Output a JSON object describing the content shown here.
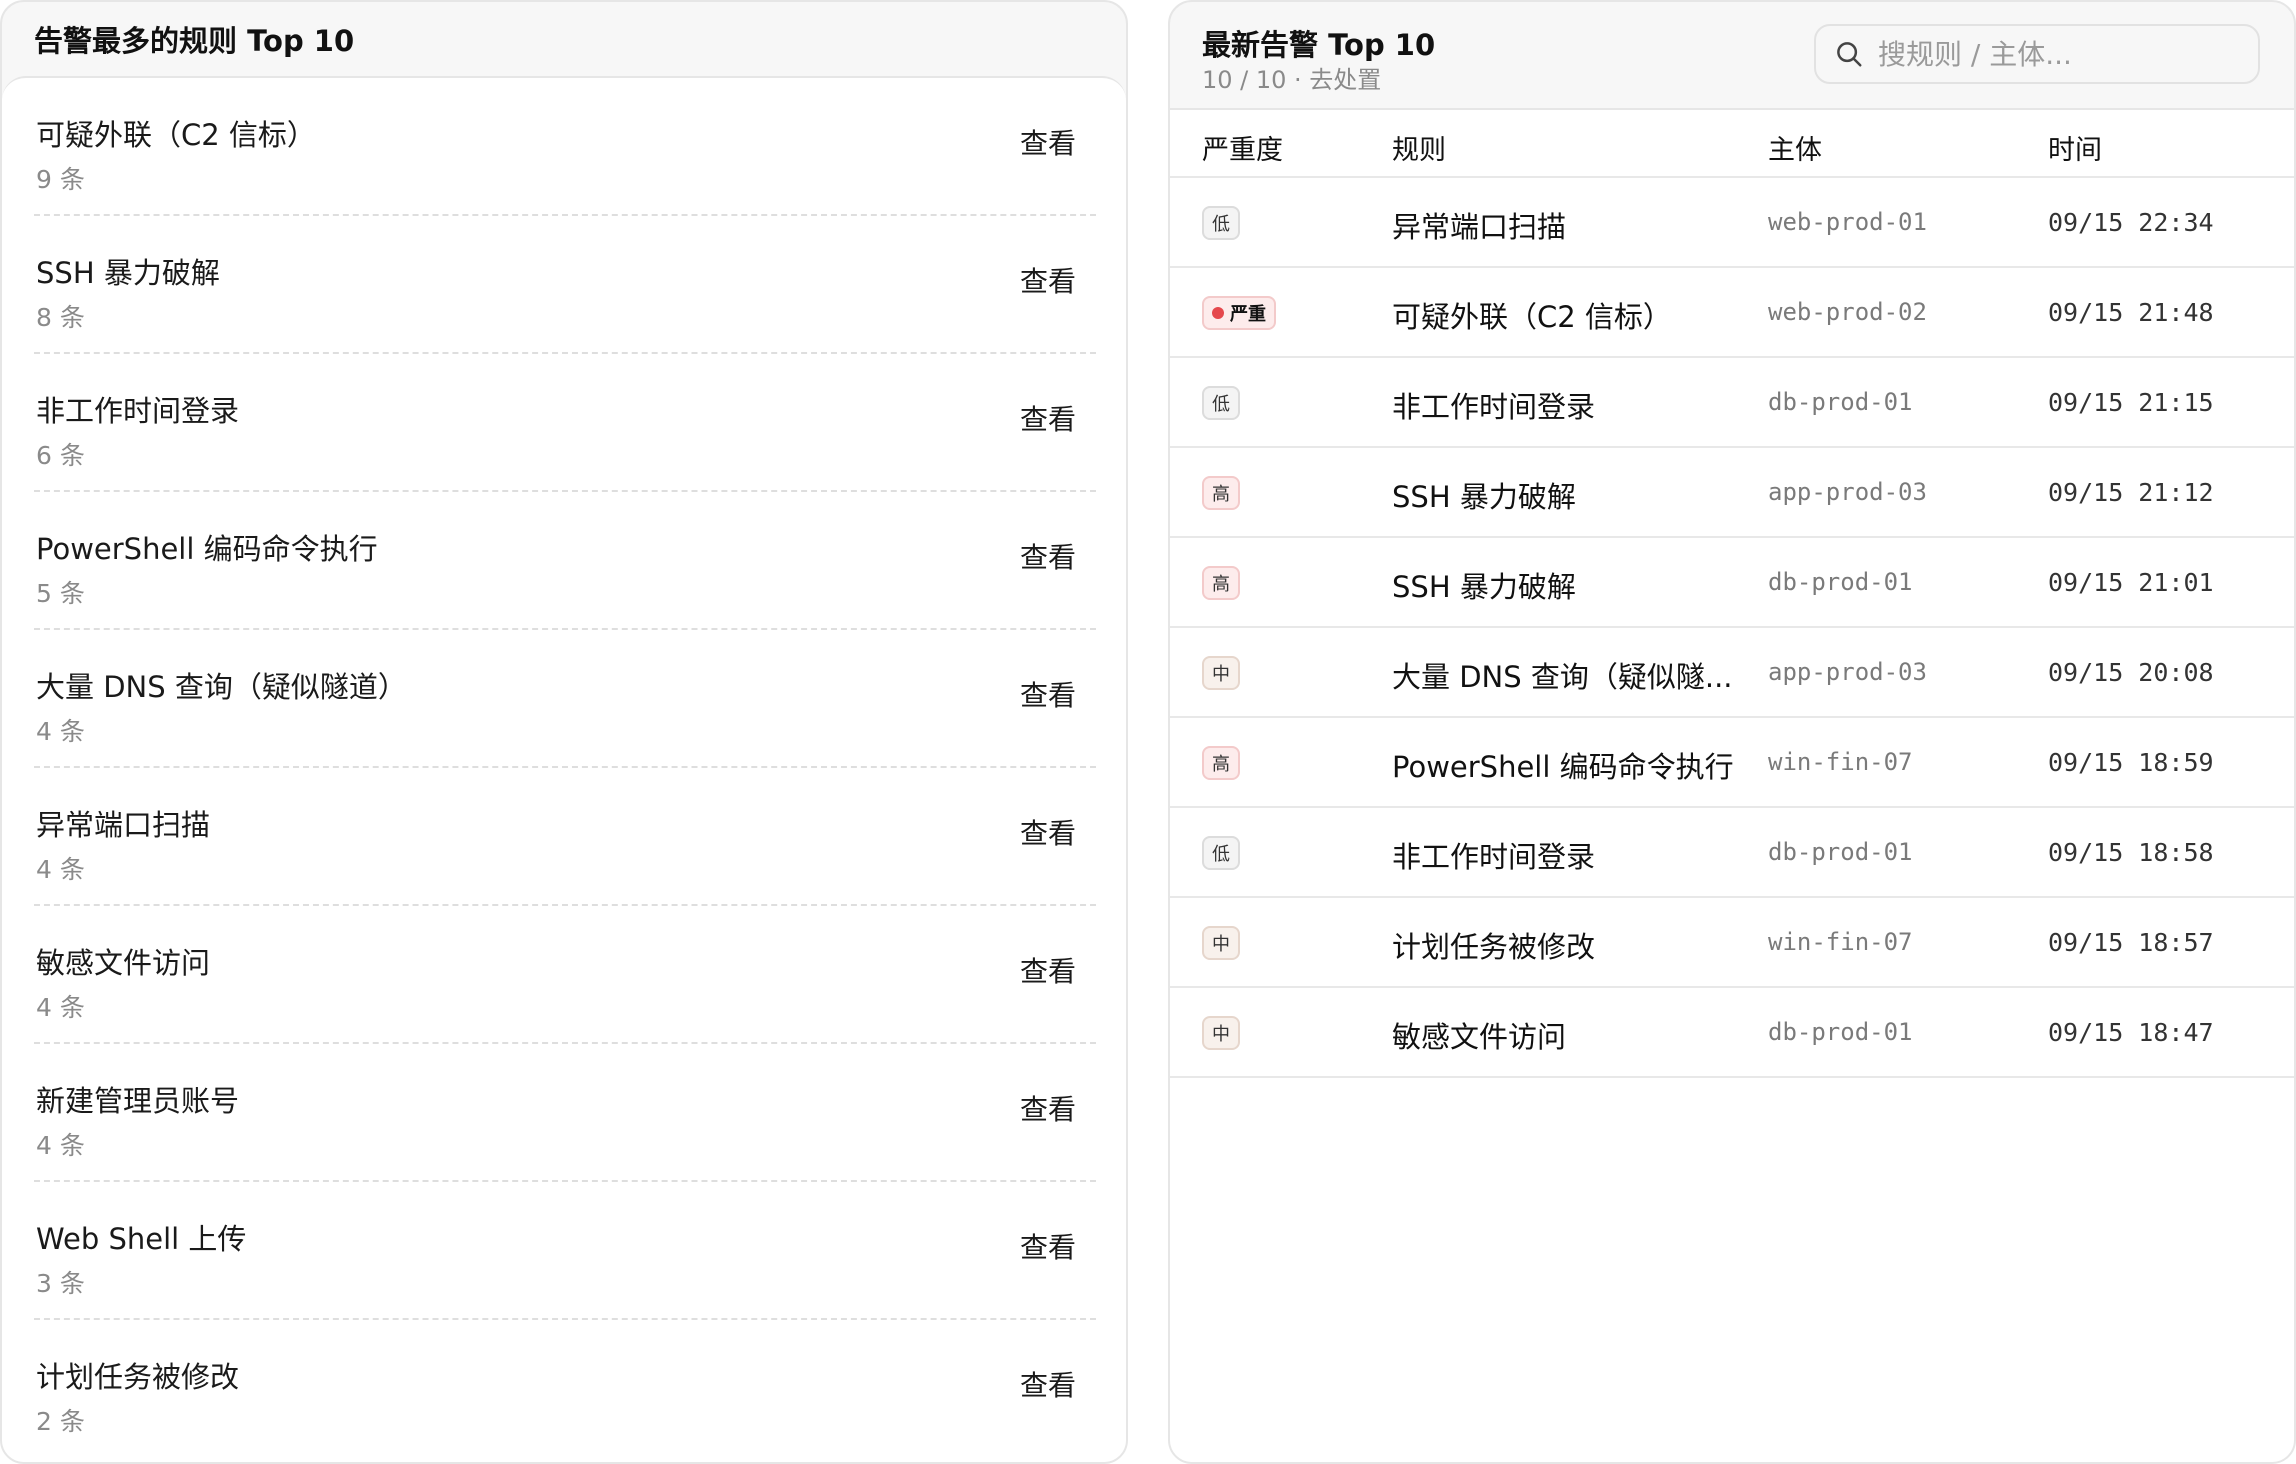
{
  "top_rules": {
    "title": "告警最多的规则 Top 10",
    "view_label": "查看",
    "items": [
      {
        "name": "可疑外联（C2 信标）",
        "count": "9 条"
      },
      {
        "name": "SSH 暴力破解",
        "count": "8 条"
      },
      {
        "name": "非工作时间登录",
        "count": "6 条"
      },
      {
        "name": "PowerShell 编码命令执行",
        "count": "5 条"
      },
      {
        "name": "大量 DNS 查询（疑似隧道）",
        "count": "4 条"
      },
      {
        "name": "异常端口扫描",
        "count": "4 条"
      },
      {
        "name": "敏感文件访问",
        "count": "4 条"
      },
      {
        "name": "新建管理员账号",
        "count": "4 条"
      },
      {
        "name": "Web Shell 上传",
        "count": "3 条"
      },
      {
        "name": "计划任务被修改",
        "count": "2 条"
      }
    ]
  },
  "latest_alerts": {
    "title": "最新告警 Top 10",
    "subtitle": "10 / 10 · 去处置",
    "search_placeholder": "搜规则 / 主体...",
    "columns": {
      "severity": "严重度",
      "rule": "规则",
      "host": "主体",
      "time": "时间"
    },
    "rows": [
      {
        "severity": "低",
        "level": "low",
        "rule": "异常端口扫描",
        "host": "web-prod-01",
        "time": "09/15 22:34"
      },
      {
        "severity": "严重",
        "level": "crit",
        "rule": "可疑外联（C2 信标）",
        "host": "web-prod-02",
        "time": "09/15 21:48"
      },
      {
        "severity": "低",
        "level": "low",
        "rule": "非工作时间登录",
        "host": "db-prod-01",
        "time": "09/15 21:15"
      },
      {
        "severity": "高",
        "level": "high",
        "rule": "SSH 暴力破解",
        "host": "app-prod-03",
        "time": "09/15 21:12"
      },
      {
        "severity": "高",
        "level": "high",
        "rule": "SSH 暴力破解",
        "host": "db-prod-01",
        "time": "09/15 21:01"
      },
      {
        "severity": "中",
        "level": "mid",
        "rule": "大量 DNS 查询（疑似隧...",
        "host": "app-prod-03",
        "time": "09/15 20:08"
      },
      {
        "severity": "高",
        "level": "high",
        "rule": "PowerShell 编码命令执行",
        "host": "win-fin-07",
        "time": "09/15 18:59"
      },
      {
        "severity": "低",
        "level": "low",
        "rule": "非工作时间登录",
        "host": "db-prod-01",
        "time": "09/15 18:58"
      },
      {
        "severity": "中",
        "level": "mid",
        "rule": "计划任务被修改",
        "host": "win-fin-07",
        "time": "09/15 18:57"
      },
      {
        "severity": "中",
        "level": "mid",
        "rule": "敏感文件访问",
        "host": "db-prod-01",
        "time": "09/15 18:47"
      }
    ]
  }
}
